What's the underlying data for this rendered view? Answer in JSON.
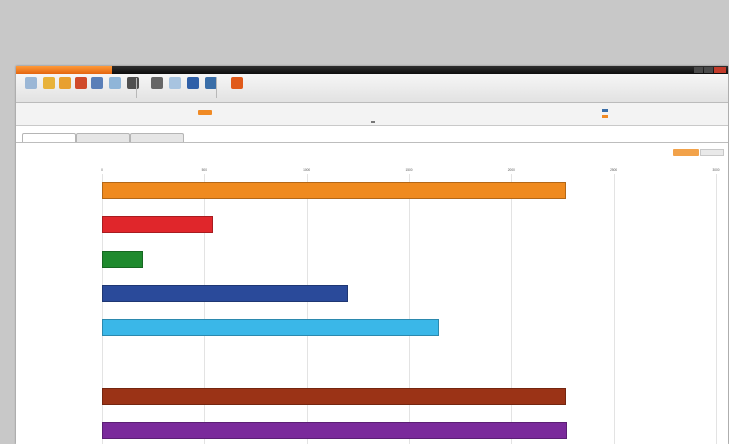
{
  "colors": {
    "accent": "#f08a24",
    "bars": [
      "#ef8a1f",
      "#e0262b",
      "#1f8a2e",
      "#2a4a9a",
      "#3ab7e8",
      "#cccccc",
      "#9b3316",
      "#7a2a9b"
    ]
  },
  "ribbon": {
    "tools": [
      {
        "icon": "document-icon",
        "color": "#9bb7d6"
      },
      {
        "icon": "open-folder-icon",
        "color": "#e8b23a"
      },
      {
        "icon": "save-icon",
        "color": "#e8a030"
      },
      {
        "icon": "export-icon",
        "color": "#d04a2a"
      },
      {
        "icon": "print-icon",
        "color": "#5a7fb8"
      },
      {
        "icon": "refresh-icon",
        "color": "#8fb5d8"
      },
      {
        "icon": "table-icon",
        "color": "#505050"
      },
      {
        "icon": "undo-icon",
        "color": "#666"
      },
      {
        "icon": "page-icon",
        "color": "#a8c4e0"
      },
      {
        "icon": "save-disk-icon",
        "color": "#3060a8"
      },
      {
        "icon": "chart-icon",
        "color": "#3a6ea8"
      },
      {
        "icon": "close-app-icon",
        "color": "#e05a1a"
      }
    ]
  },
  "chart_data": {
    "type": "bar",
    "orientation": "horizontal",
    "x_ticks": [
      "0",
      "500",
      "1000",
      "1500",
      "2000",
      "2500",
      "3000"
    ],
    "xlim": [
      0,
      3000
    ],
    "categories": [
      "",
      "",
      "",
      "",
      "",
      "",
      "",
      ""
    ],
    "values": [
      2265,
      540,
      200,
      1200,
      1645,
      0,
      2265,
      2270
    ],
    "grid": true,
    "legend": "none"
  }
}
